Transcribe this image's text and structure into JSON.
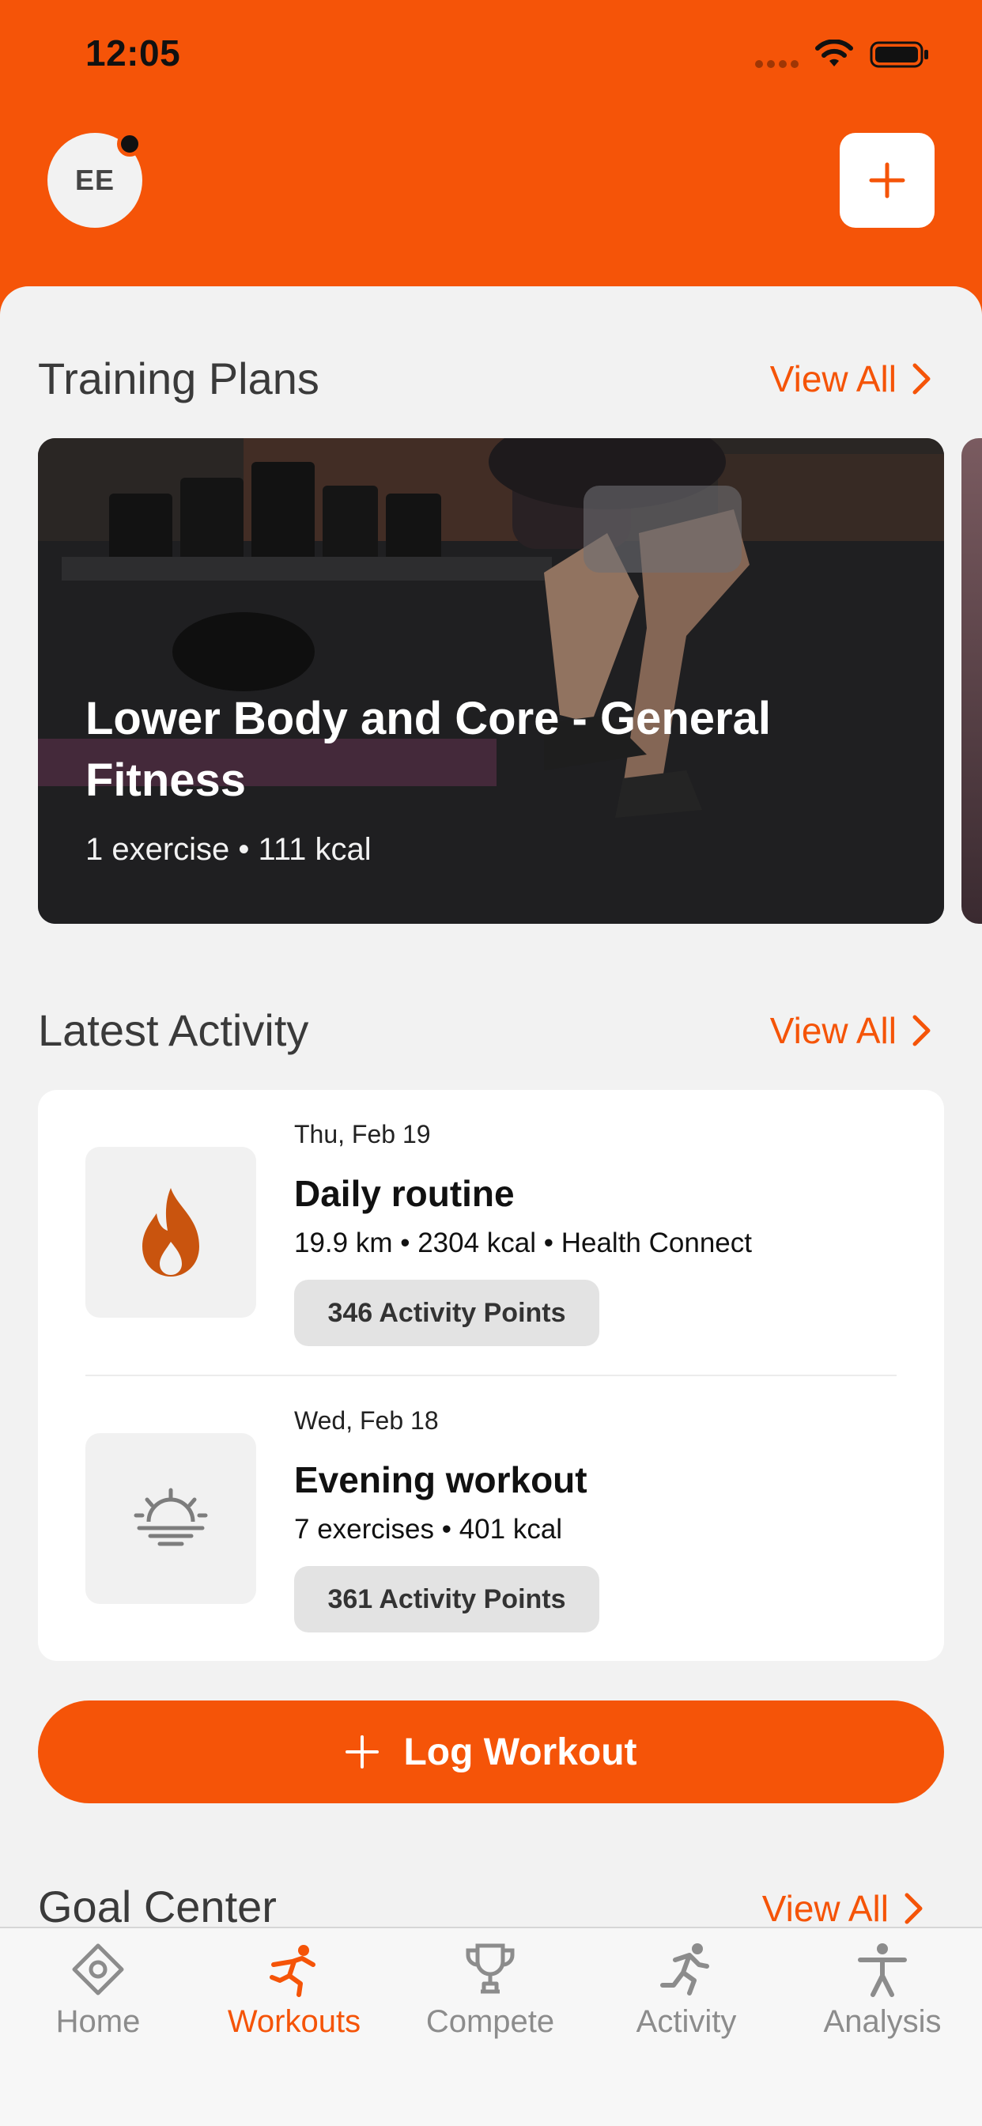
{
  "status_bar": {
    "time": "12:05"
  },
  "header": {
    "avatar_initials": "EE"
  },
  "training_plans": {
    "title": "Training Plans",
    "view_all": "View All",
    "plan": {
      "title": "Lower Body and Core - General Fitness",
      "meta": "1 exercise • 111 kcal"
    }
  },
  "latest_activity": {
    "title": "Latest Activity",
    "view_all": "View All",
    "items": [
      {
        "date": "Thu, Feb 19",
        "title": "Daily routine",
        "meta": "19.9 km • 2304 kcal • Health Connect",
        "points": "346 Activity Points",
        "icon": "flame-icon"
      },
      {
        "date": "Wed, Feb 18",
        "title": "Evening workout",
        "meta": "7 exercises • 401 kcal",
        "points": "361 Activity Points",
        "icon": "sunset-icon"
      }
    ]
  },
  "log_workout": {
    "label": "Log Workout"
  },
  "goal_center": {
    "title": "Goal Center",
    "view_all": "View All"
  },
  "tabs": [
    {
      "label": "Home",
      "icon": "home-icon"
    },
    {
      "label": "Workouts",
      "icon": "workouts-icon",
      "active": true
    },
    {
      "label": "Compete",
      "icon": "trophy-icon"
    },
    {
      "label": "Activity",
      "icon": "running-icon"
    },
    {
      "label": "Analysis",
      "icon": "person-icon"
    }
  ],
  "colors": {
    "accent": "#f55408",
    "background": "#f2f2f2",
    "card": "#ffffff"
  }
}
